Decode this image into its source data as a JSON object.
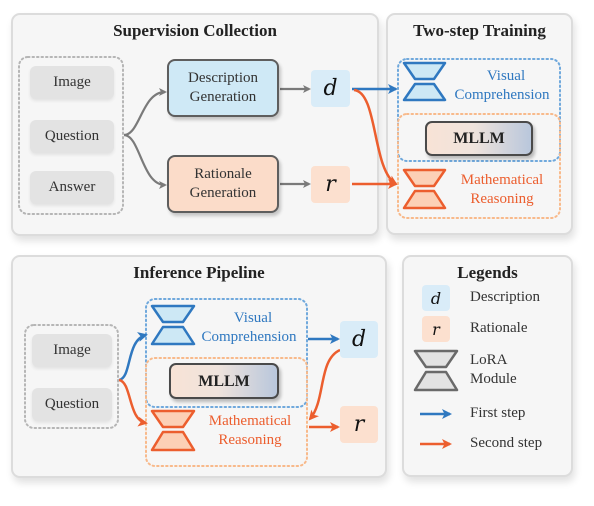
{
  "colors": {
    "blue": "#2f78c0",
    "blue_fill": "#cde8f5",
    "orange": "#ec5e2e",
    "orange_fill": "#fcd7c2",
    "orange_dotted": "#f8b98a",
    "blue_dotted": "#6fa8dc",
    "gray_arrow": "#7a7a7a",
    "description_fill": "#d9ecf8",
    "rationale_fill": "#fce0cf",
    "description_gen_fill": "#cfe9f6",
    "rationale_gen_fill": "#fbdcc9"
  },
  "supervision": {
    "title": "Supervision Collection",
    "inputs": [
      "Image",
      "Question",
      "Answer"
    ],
    "description_gen": "Description Generation",
    "rationale_gen": "Rationale Generation",
    "d_symbol": "d",
    "r_symbol": "r"
  },
  "training": {
    "title": "Two-step Training",
    "visual_label": "Visual Comprehension",
    "visual_line1": "Visual",
    "visual_line2": "Comprehension",
    "mllm": "MLLM",
    "math_line1": "Mathematical",
    "math_line2": "Reasoning"
  },
  "inference": {
    "title": "Inference Pipeline",
    "inputs": [
      "Image",
      "Question"
    ],
    "visual_line1": "Visual",
    "visual_line2": "Comprehension",
    "mllm": "MLLM",
    "math_line1": "Mathematical",
    "math_line2": "Reasoning",
    "d_symbol": "d",
    "r_symbol": "r"
  },
  "legends": {
    "title": "Legends",
    "items": [
      {
        "symbol": "d",
        "label": "Description"
      },
      {
        "symbol": "r",
        "label": "Rationale"
      },
      {
        "symbol": "lora",
        "label_line1": "LoRA",
        "label_line2": "Module"
      },
      {
        "symbol": "blue-arrow",
        "label": "First step"
      },
      {
        "symbol": "orange-arrow",
        "label": "Second step"
      }
    ]
  }
}
